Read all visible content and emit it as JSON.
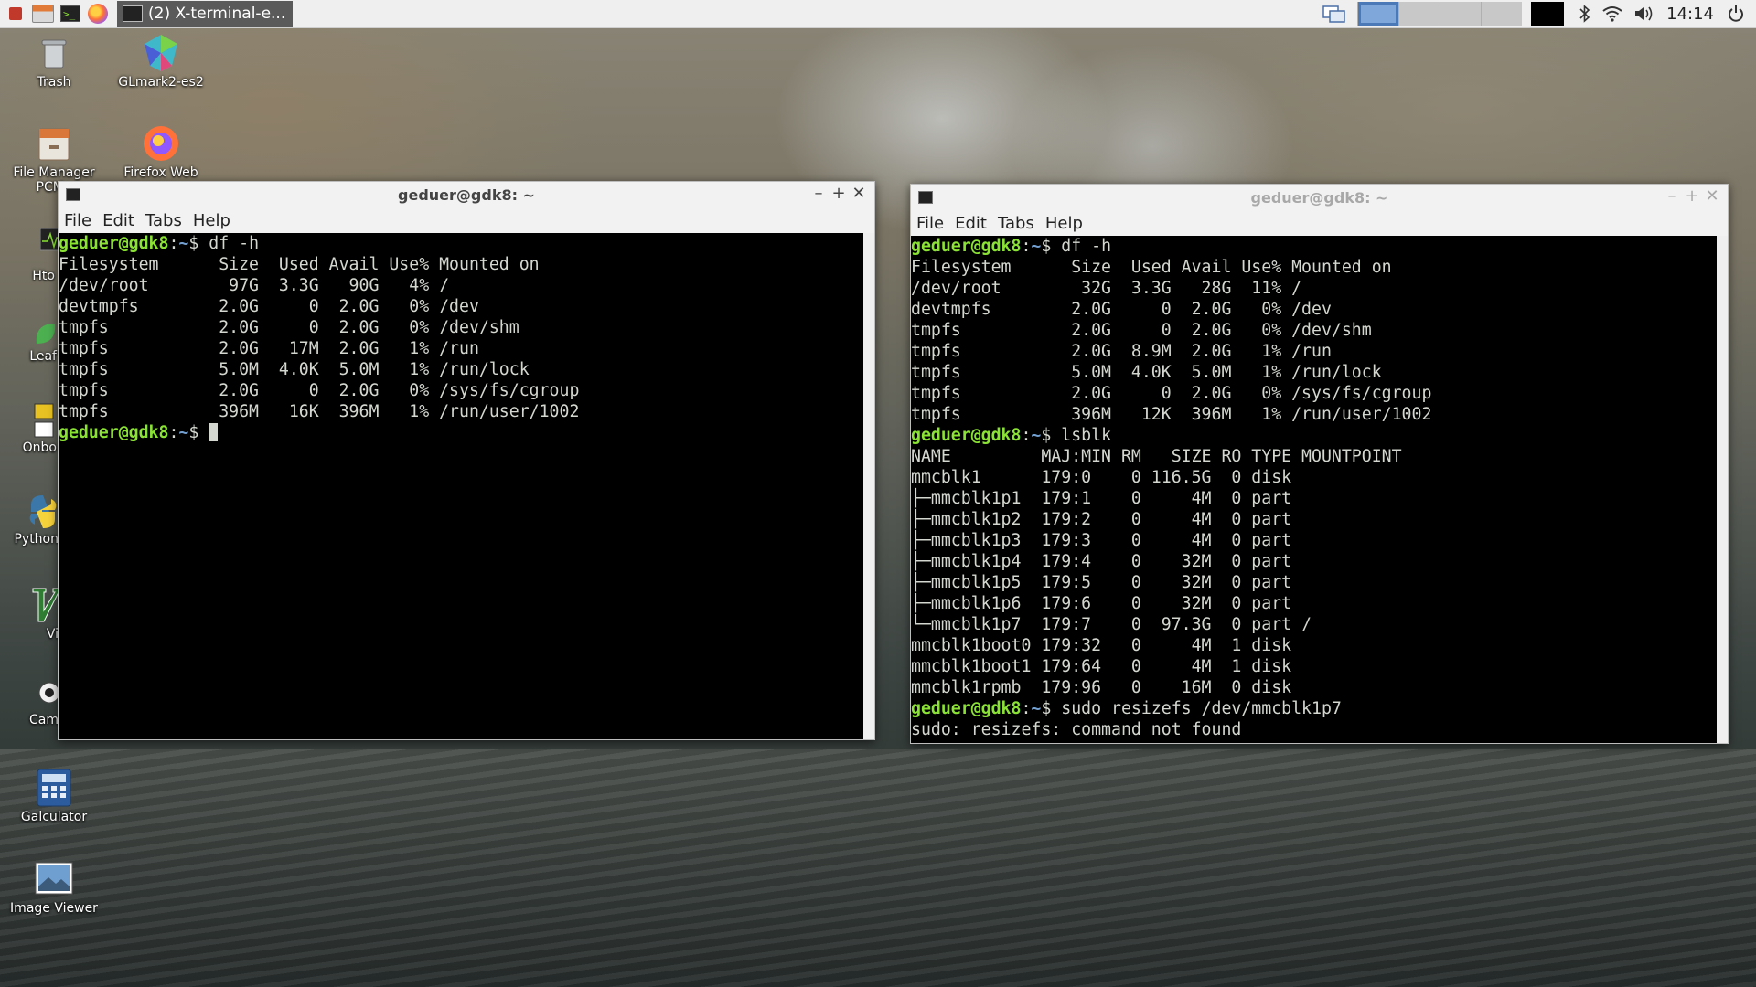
{
  "panel": {
    "task_title": "(2) X-terminal-e...",
    "clock": "14:14"
  },
  "desktop_icons": [
    {
      "label": "Trash"
    },
    {
      "label": "GLmark2-es2"
    },
    {
      "label": "File Manager PCMa"
    },
    {
      "label": "Firefox Web"
    },
    {
      "label": "Hto"
    },
    {
      "label": "Leaf"
    },
    {
      "label": "Onbo"
    },
    {
      "label": "Python"
    },
    {
      "label": "Vi"
    },
    {
      "label": "Cam"
    },
    {
      "label": "Galculator"
    },
    {
      "label": "Image Viewer"
    }
  ],
  "menu": {
    "file": "File",
    "edit": "Edit",
    "tabs": "Tabs",
    "help": "Help"
  },
  "window_controls": {
    "min": "–",
    "max": "+",
    "close": "✕"
  },
  "prompt": {
    "user": "geduer@gdk8",
    "sep": ":",
    "path": "~",
    "dollar": "$ "
  },
  "left_terminal": {
    "title": "geduer@gdk8: ~",
    "lines": [
      {
        "type": "cmd",
        "text": "df -h"
      },
      {
        "type": "out",
        "text": "Filesystem      Size  Used Avail Use% Mounted on"
      },
      {
        "type": "out",
        "text": "/dev/root        97G  3.3G   90G   4% /"
      },
      {
        "type": "out",
        "text": "devtmpfs        2.0G     0  2.0G   0% /dev"
      },
      {
        "type": "out",
        "text": "tmpfs           2.0G     0  2.0G   0% /dev/shm"
      },
      {
        "type": "out",
        "text": "tmpfs           2.0G   17M  2.0G   1% /run"
      },
      {
        "type": "out",
        "text": "tmpfs           5.0M  4.0K  5.0M   1% /run/lock"
      },
      {
        "type": "out",
        "text": "tmpfs           2.0G     0  2.0G   0% /sys/fs/cgroup"
      },
      {
        "type": "out",
        "text": "tmpfs           396M   16K  396M   1% /run/user/1002"
      },
      {
        "type": "cursor",
        "text": ""
      }
    ]
  },
  "right_terminal": {
    "title": "geduer@gdk8: ~",
    "lines": [
      {
        "type": "cmd",
        "text": "df -h"
      },
      {
        "type": "out",
        "text": "Filesystem      Size  Used Avail Use% Mounted on"
      },
      {
        "type": "out",
        "text": "/dev/root        32G  3.3G   28G  11% /"
      },
      {
        "type": "out",
        "text": "devtmpfs        2.0G     0  2.0G   0% /dev"
      },
      {
        "type": "out",
        "text": "tmpfs           2.0G     0  2.0G   0% /dev/shm"
      },
      {
        "type": "out",
        "text": "tmpfs           2.0G  8.9M  2.0G   1% /run"
      },
      {
        "type": "out",
        "text": "tmpfs           5.0M  4.0K  5.0M   1% /run/lock"
      },
      {
        "type": "out",
        "text": "tmpfs           2.0G     0  2.0G   0% /sys/fs/cgroup"
      },
      {
        "type": "out",
        "text": "tmpfs           396M   12K  396M   1% /run/user/1002"
      },
      {
        "type": "cmd",
        "text": "lsblk"
      },
      {
        "type": "out",
        "text": "NAME         MAJ:MIN RM   SIZE RO TYPE MOUNTPOINT"
      },
      {
        "type": "out",
        "text": "mmcblk1      179:0    0 116.5G  0 disk"
      },
      {
        "type": "out",
        "text": "├─mmcblk1p1  179:1    0     4M  0 part"
      },
      {
        "type": "out",
        "text": "├─mmcblk1p2  179:2    0     4M  0 part"
      },
      {
        "type": "out",
        "text": "├─mmcblk1p3  179:3    0     4M  0 part"
      },
      {
        "type": "out",
        "text": "├─mmcblk1p4  179:4    0    32M  0 part"
      },
      {
        "type": "out",
        "text": "├─mmcblk1p5  179:5    0    32M  0 part"
      },
      {
        "type": "out",
        "text": "├─mmcblk1p6  179:6    0    32M  0 part"
      },
      {
        "type": "out",
        "text": "└─mmcblk1p7  179:7    0  97.3G  0 part /"
      },
      {
        "type": "out",
        "text": "mmcblk1boot0 179:32   0     4M  1 disk"
      },
      {
        "type": "out",
        "text": "mmcblk1boot1 179:64   0     4M  1 disk"
      },
      {
        "type": "out",
        "text": "mmcblk1rpmb  179:96   0    16M  0 disk"
      },
      {
        "type": "cmd",
        "text": "sudo resizefs /dev/mmcblk1p7"
      },
      {
        "type": "out",
        "text": "sudo: resizefs: command not found"
      }
    ]
  }
}
